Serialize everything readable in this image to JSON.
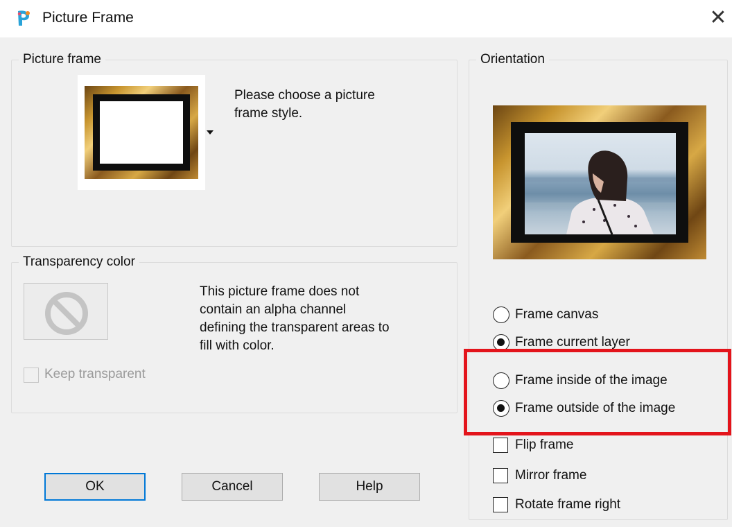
{
  "window": {
    "title": "Picture Frame",
    "close_glyph": "✕"
  },
  "picture_frame_group": {
    "label": "Picture frame",
    "instruction": [
      "Please choose a picture",
      "frame style."
    ]
  },
  "transparency_group": {
    "label": "Transparency color",
    "message": [
      "This picture frame does not",
      "contain an alpha channel",
      "defining the transparent areas to",
      "fill with color."
    ],
    "keep_transparent_label": "Keep transparent",
    "keep_transparent_checked": false,
    "swatch_icon": "no-symbol-icon"
  },
  "orientation_group": {
    "label": "Orientation",
    "preview": "woman-by-sea-photo",
    "radios_target": [
      {
        "label": "Frame canvas",
        "checked": false
      },
      {
        "label": "Frame current layer",
        "checked": true
      }
    ],
    "radios_position": [
      {
        "label": "Frame inside of the image",
        "checked": false
      },
      {
        "label": "Frame outside of the image",
        "checked": true
      }
    ],
    "checkboxes": [
      {
        "label": "Flip frame",
        "checked": false
      },
      {
        "label": "Mirror frame",
        "checked": false
      },
      {
        "label": "Rotate frame right",
        "checked": false
      }
    ]
  },
  "buttons": {
    "ok": "OK",
    "cancel": "Cancel",
    "help": "Help"
  },
  "colors": {
    "highlight": "#e3141b",
    "default_button_border": "#0078d7",
    "dialog_bg": "#f0f0f0"
  }
}
